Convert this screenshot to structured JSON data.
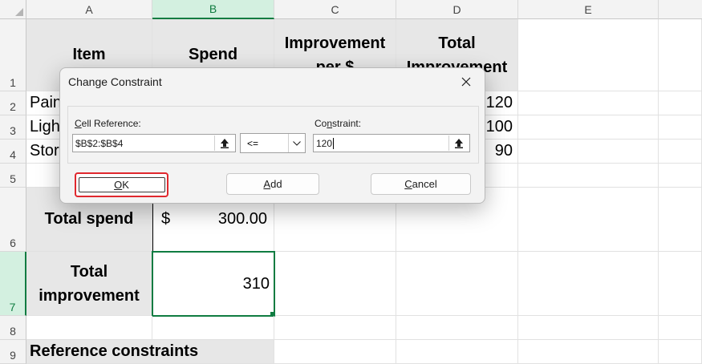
{
  "columns": [
    "A",
    "B",
    "C",
    "D",
    "E"
  ],
  "rows": [
    "1",
    "2",
    "3",
    "4",
    "5",
    "6",
    "7",
    "8",
    "9"
  ],
  "headers": {
    "item": "Item",
    "spend": "Spend",
    "improvement_line1": "Improvement",
    "improvement_line2": "per $",
    "total_line1": "Total",
    "total_line2": "Improvement"
  },
  "item_cells": [
    "Pain",
    "Ligh",
    "Stor"
  ],
  "total_improvement_values": [
    "120",
    "100",
    "90"
  ],
  "total_spend_label": "Total spend",
  "total_spend_currency": "$",
  "total_spend_value": "300.00",
  "total_improvement_label_line1": "Total",
  "total_improvement_label_line2": "improvement",
  "total_improvement_value": "310",
  "reference_constraints": "Reference constraints",
  "dialog": {
    "title": "Change Constraint",
    "cell_reference_label_u": "C",
    "cell_reference_label_rest": "ell Reference:",
    "cell_reference_value": "$B$2:$B$4",
    "operator": "<=",
    "constraint_label_pre": "Co",
    "constraint_label_u": "n",
    "constraint_label_rest": "straint:",
    "constraint_value": "120",
    "ok_u": "O",
    "ok_rest": "K",
    "add_u": "A",
    "add_rest": "dd",
    "cancel_u": "C",
    "cancel_rest": "ancel"
  },
  "colors": {
    "selection_green": "#107c41",
    "header_fill": "#e7e7e7",
    "focus_red": "#e0282e"
  }
}
